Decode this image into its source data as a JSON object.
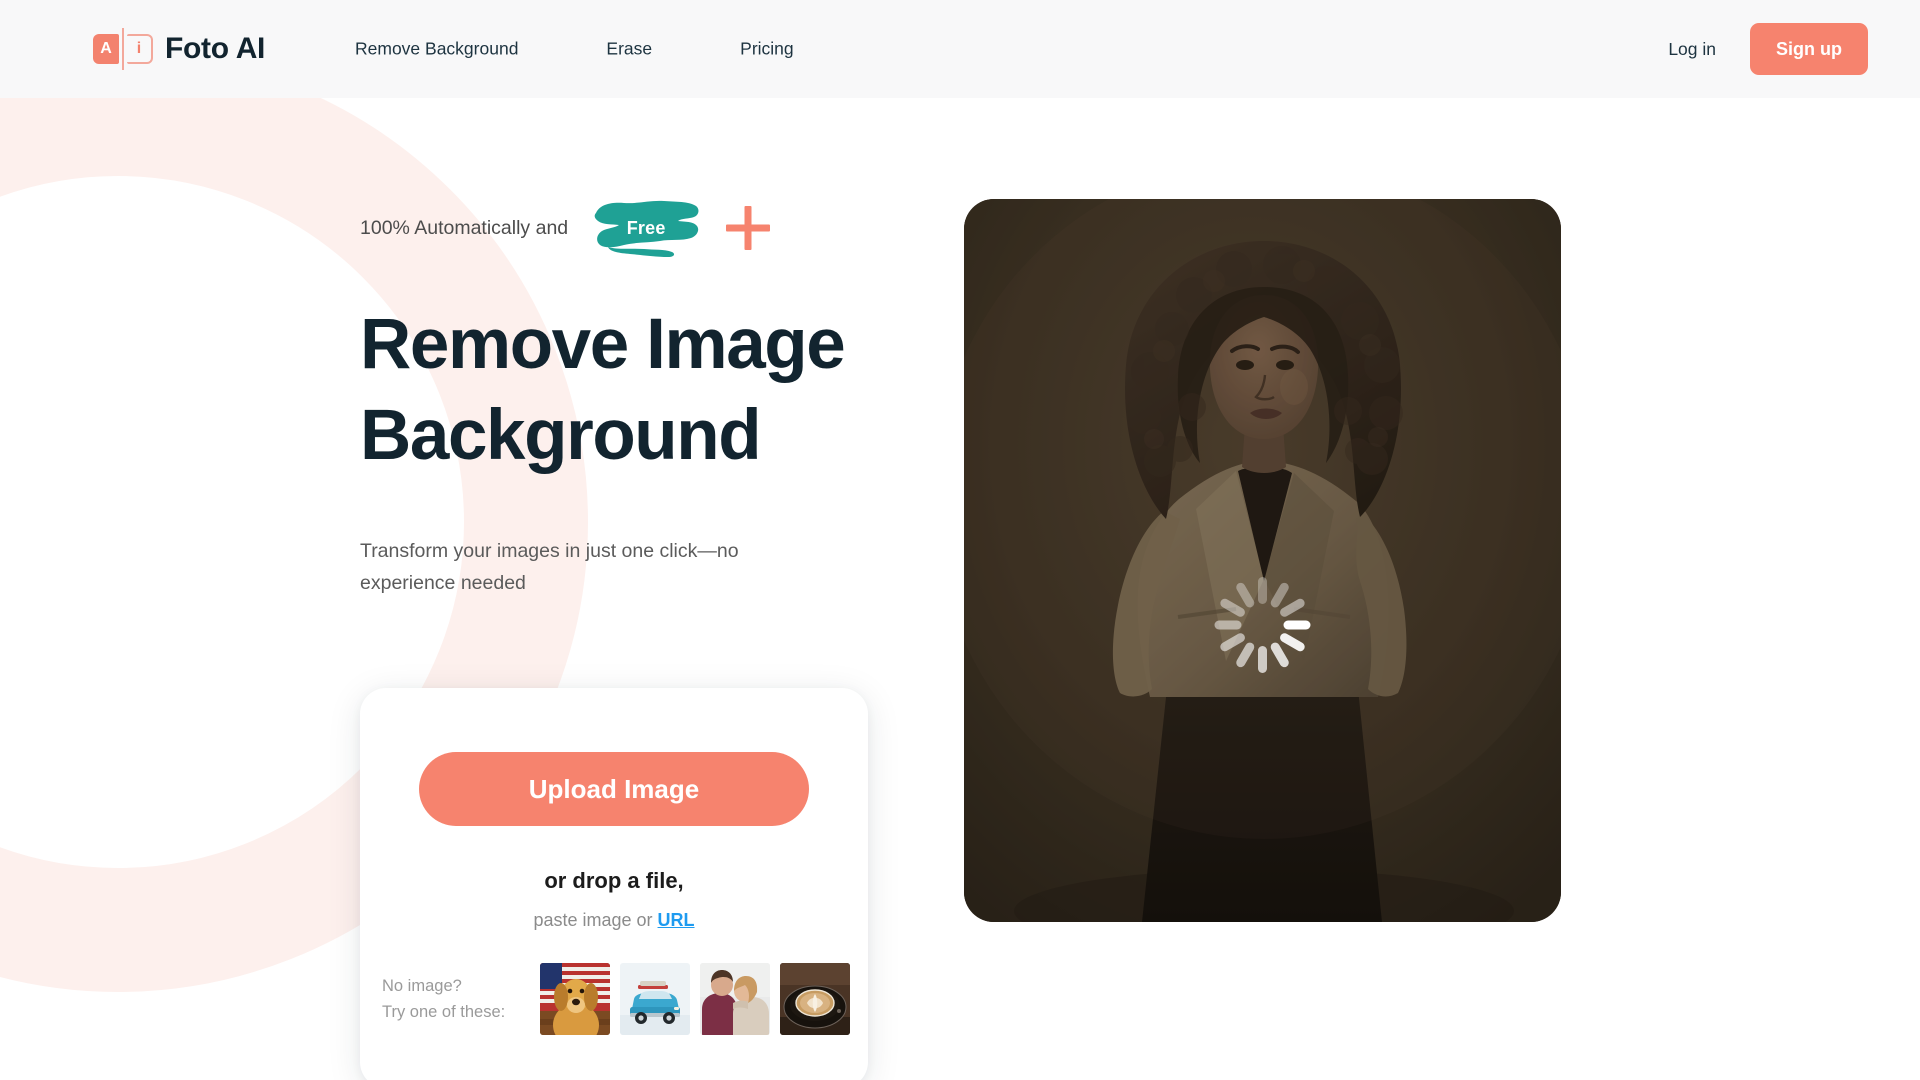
{
  "header": {
    "brand": {
      "logo_letter_1": "A",
      "logo_letter_2": "i",
      "name": "Foto AI"
    },
    "nav": [
      {
        "label": "Remove Background"
      },
      {
        "label": "Erase"
      },
      {
        "label": "Pricing"
      }
    ],
    "login_label": "Log in",
    "signup_label": "Sign up",
    "background_color": "#f8f8f9"
  },
  "hero": {
    "eyebrow_text": "100% Automatically and",
    "free_badge_label": "Free",
    "plus_icon": "plus-icon",
    "headline_line_1": "Remove Image",
    "headline_line_2": "Background",
    "subhead": "Transform your images in just one click—no experience needed",
    "headline_color": "#12242f",
    "accent_color": "#f6836e",
    "badge_color": "#1fa195",
    "decor_ring_color": "#fdf0ed"
  },
  "upload_card": {
    "upload_button_label": "Upload Image",
    "drop_title": "or drop a file,",
    "paste_prefix": "paste image or ",
    "url_link_label": "URL",
    "samples_label_line_1": "No image?",
    "samples_label_line_2": "Try one of these:",
    "samples": [
      {
        "name": "golden-retriever-with-flag"
      },
      {
        "name": "blue-vintage-car-in-snow"
      },
      {
        "name": "couple-embracing-in-winter"
      },
      {
        "name": "cappuccino-cup-on-saucer"
      }
    ],
    "link_color": "#1e9bf0"
  },
  "preview": {
    "image_alt": "woman-with-curly-hair-in-beige-jacket",
    "background_color": "#3a3026",
    "status": "loading",
    "spinner_segments": 12
  }
}
